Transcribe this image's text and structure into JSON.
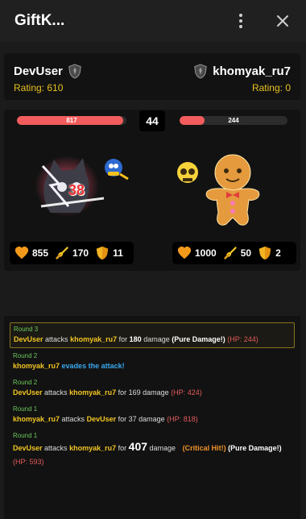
{
  "header": {
    "title": "GiftK..."
  },
  "players": {
    "left": {
      "name": "DevUser",
      "rating": "Rating: 610"
    },
    "right": {
      "name": "khomyak_ru7",
      "rating": "Rating: 0"
    }
  },
  "battle": {
    "round": "44",
    "left_hp": "817",
    "left_hp_fraction": 0.97,
    "right_hp": "244",
    "right_hp_fraction": 0.23,
    "damage_popup": "38",
    "left_stats": {
      "hp": "855",
      "attack": "170",
      "defense": "11"
    },
    "right_stats": {
      "hp": "1000",
      "attack": "50",
      "defense": "2"
    }
  },
  "log": [
    {
      "round": "Round 3",
      "attacker": "DevUser",
      "verb": "attacks",
      "target": "khomyak_ru7",
      "for": "for",
      "value": "180",
      "unit": "damage",
      "tag": "(Pure Damage!)",
      "hp": "(HP: 244)"
    },
    {
      "round": "Round 2",
      "attacker": "khomyak_ru7",
      "evade": "evades the attack!"
    },
    {
      "round": "Round 2",
      "attacker": "DevUser",
      "verb": "attacks",
      "target": "khomyak_ru7",
      "text": "for 169 damage",
      "hp": "(HP: 424)"
    },
    {
      "round": "Round 1",
      "attacker": "khomyak_ru7",
      "verb": "attacks",
      "target": "DevUser",
      "text": "for 37 damage",
      "hp": "(HP: 818)"
    },
    {
      "round": "Round 1",
      "attacker": "DevUser",
      "verb": "attacks",
      "target": "khomyak_ru7",
      "for": "for",
      "value": "407",
      "unit": "damage",
      "crit": "(Critical Hit!)",
      "tag": "(Pure Damage!)",
      "hp": "(HP: 593)"
    }
  ],
  "icons": {
    "close": "close-icon",
    "menu": "more-vertical-icon",
    "rank": "rank-shield-icon",
    "hp": "heart-icon",
    "attack": "sword-icon",
    "defense": "shield-icon"
  },
  "colors": {
    "hp_bar": "#f25c5c",
    "name_highlight": "#f3c522",
    "round_label": "#6bc75a",
    "evade": "#38a8f0",
    "crit": "#f0932b",
    "hp_text": "#e35b5b"
  }
}
